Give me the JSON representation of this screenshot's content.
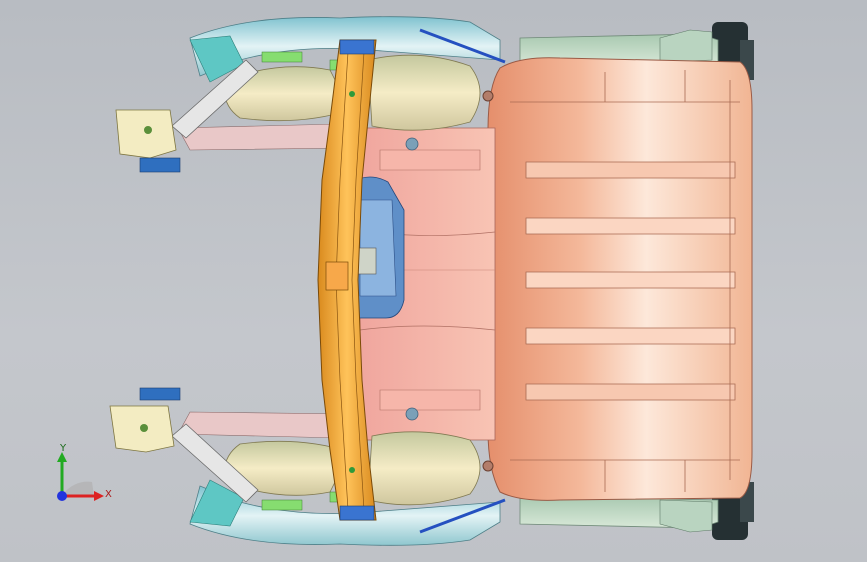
{
  "viewport": {
    "background": "#c1c4c9"
  },
  "model": {
    "floor_color": "#f0b79a",
    "floor_highlight": "#fde6d6",
    "tunnel_color": "#f2a59c",
    "crossmember_color": "#f0a830",
    "wheelhouse_color": "#efe2b2",
    "rail_color": "#9ad0d8",
    "rail_highlight": "#d9eef2",
    "bracket_color": "#f4ecc4",
    "tire_color": "#2a3538",
    "blue_part_color": "#2c63c9",
    "green_part_color": "#7dd66b",
    "pillar_color": "#c9d9c3"
  },
  "triad": {
    "y_label": "Y",
    "x_label": "X",
    "y_color": "#22aa22",
    "x_color": "#dd2222",
    "z_color": "#2233dd"
  }
}
